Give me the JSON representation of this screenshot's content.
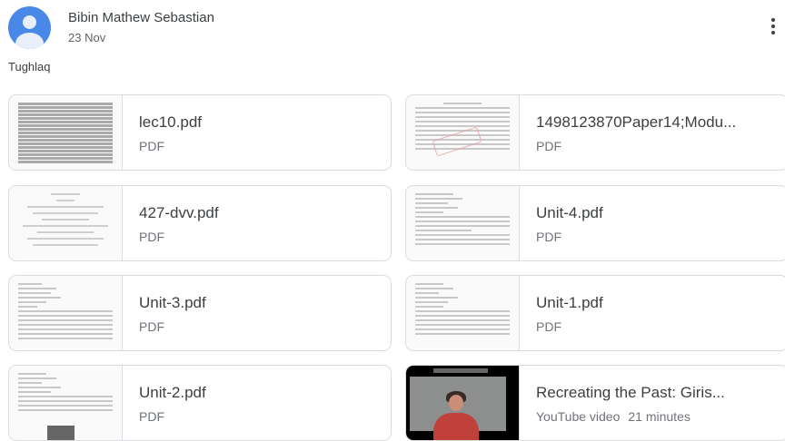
{
  "post": {
    "author": "Bibin Mathew Sebastian",
    "date": "23 Nov",
    "description": "Tughlaq"
  },
  "attachments": [
    {
      "title": "lec10.pdf",
      "type": "PDF",
      "icon": "pdf-thumbnail"
    },
    {
      "title": "1498123870Paper14;Modu...",
      "type": "PDF",
      "icon": "pdf-thumbnail"
    },
    {
      "title": "427-dvv.pdf",
      "type": "PDF",
      "icon": "pdf-thumbnail"
    },
    {
      "title": "Unit-4.pdf",
      "type": "PDF",
      "icon": "pdf-thumbnail"
    },
    {
      "title": "Unit-3.pdf",
      "type": "PDF",
      "icon": "pdf-thumbnail"
    },
    {
      "title": "Unit-1.pdf",
      "type": "PDF",
      "icon": "pdf-thumbnail"
    },
    {
      "title": "Unit-2.pdf",
      "type": "PDF",
      "icon": "pdf-thumbnail"
    },
    {
      "title": "Recreating the Past: Giris...",
      "type": "YouTube video",
      "duration": "21 minutes",
      "icon": "video-thumbnail"
    }
  ],
  "colors": {
    "avatar": "#4a88e8",
    "border": "#dadce0",
    "text": "#3c4043",
    "subtext": "#6f7378"
  }
}
